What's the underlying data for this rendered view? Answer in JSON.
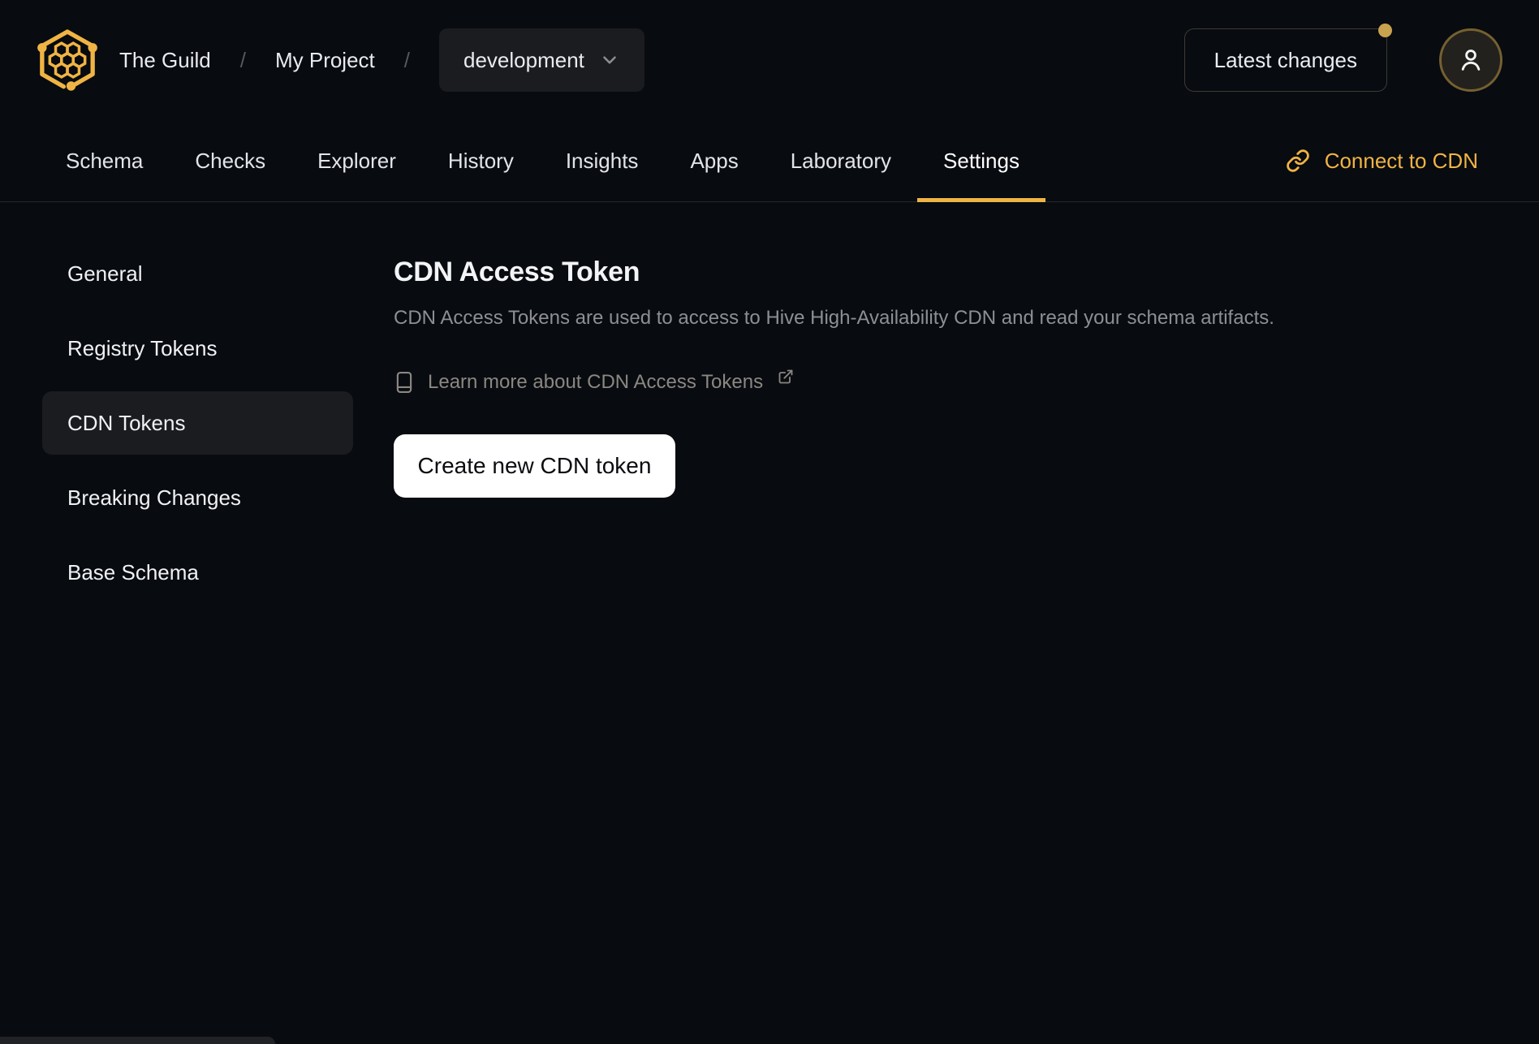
{
  "header": {
    "breadcrumb": {
      "org": "The Guild",
      "separator": "/",
      "project": "My Project",
      "target": "development"
    },
    "latest_changes_label": "Latest changes",
    "icons": {
      "logo": "hive-honeycomb-logo",
      "target_chevron": "chevron-down-icon",
      "avatar": "user-icon",
      "notification": "notification-dot"
    }
  },
  "tabs": {
    "items": [
      {
        "label": "Schema",
        "active": false
      },
      {
        "label": "Checks",
        "active": false
      },
      {
        "label": "Explorer",
        "active": false
      },
      {
        "label": "History",
        "active": false
      },
      {
        "label": "Insights",
        "active": false
      },
      {
        "label": "Apps",
        "active": false
      },
      {
        "label": "Laboratory",
        "active": false
      },
      {
        "label": "Settings",
        "active": true
      }
    ],
    "connect_cdn_label": "Connect to CDN",
    "connect_cdn_icon": "link-icon"
  },
  "sidebar": {
    "items": [
      {
        "label": "General",
        "active": false
      },
      {
        "label": "Registry Tokens",
        "active": false
      },
      {
        "label": "CDN Tokens",
        "active": true
      },
      {
        "label": "Breaking Changes",
        "active": false
      },
      {
        "label": "Base Schema",
        "active": false
      }
    ]
  },
  "main": {
    "title": "CDN Access Token",
    "description": "CDN Access Tokens are used to access to Hive High-Availability CDN and read your schema artifacts.",
    "learn_more_label": "Learn more about CDN Access Tokens",
    "learn_more_icons": [
      "book-icon",
      "external-link-icon"
    ],
    "create_button_label": "Create new CDN token"
  },
  "colors": {
    "background": "#080b10",
    "accent": "#f0b444",
    "notification_dot": "#c9a24f",
    "avatar_ring": "#756030",
    "active_item_bg": "#1b1c1f",
    "muted_text": "#8d8f94",
    "button_bg": "#ffffff",
    "button_text": "#0a0c10"
  }
}
